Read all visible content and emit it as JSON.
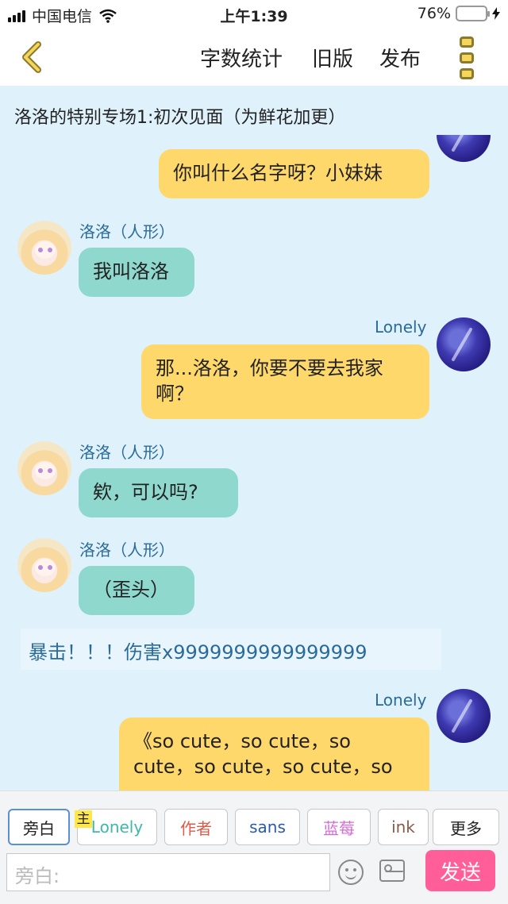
{
  "status_bar": {
    "carrier": "中国电信",
    "time": "上午1:39",
    "battery": "76%",
    "battery_level": 0.76
  },
  "nav": {
    "word_count": "字数统计",
    "old_version": "旧版",
    "publish": "发布"
  },
  "chapter_title": "洛洛的特别专场1:初次见面（为鲜花加更）",
  "messages": [
    {
      "speaker": "",
      "side": "right",
      "text": "你叫什么名字呀？小妹妹"
    },
    {
      "speaker": "洛洛（人形）",
      "side": "left",
      "text": "我叫洛洛"
    },
    {
      "speaker": "Lonely",
      "side": "right",
      "text": "那...洛洛，你要不要去我家啊？"
    },
    {
      "speaker": "洛洛（人形）",
      "side": "left",
      "text": "欸，可以吗?"
    },
    {
      "speaker": "洛洛（人形）",
      "side": "left",
      "text": "（歪头）"
    },
    {
      "speaker": "",
      "side": "narration",
      "text": "暴击！！！伤害x9999999999999999"
    },
    {
      "speaker": "Lonely",
      "side": "right",
      "text": "《so cute，so cute，so cute，so cute，so cute，so"
    }
  ],
  "roles": {
    "main_badge": "主",
    "items": [
      {
        "label": "旁白",
        "color": "#222222"
      },
      {
        "label": "Lonely",
        "color": "#3fb8a8"
      },
      {
        "label": "作者",
        "color": "#e05a4a"
      },
      {
        "label": "sans",
        "color": "#2a5aa8"
      },
      {
        "label": "蓝莓",
        "color": "#d86ad8"
      },
      {
        "label": "ink",
        "color": "#8a5a4a"
      },
      {
        "label": "更多",
        "color": "#222222"
      }
    ]
  },
  "composer": {
    "placeholder": "旁白:",
    "send": "发送"
  },
  "colors": {
    "background": "#dff1fb",
    "yellow_bubble": "#ffd86b",
    "teal_bubble": "#8fd8cd",
    "send_button": "#ff5e99"
  }
}
